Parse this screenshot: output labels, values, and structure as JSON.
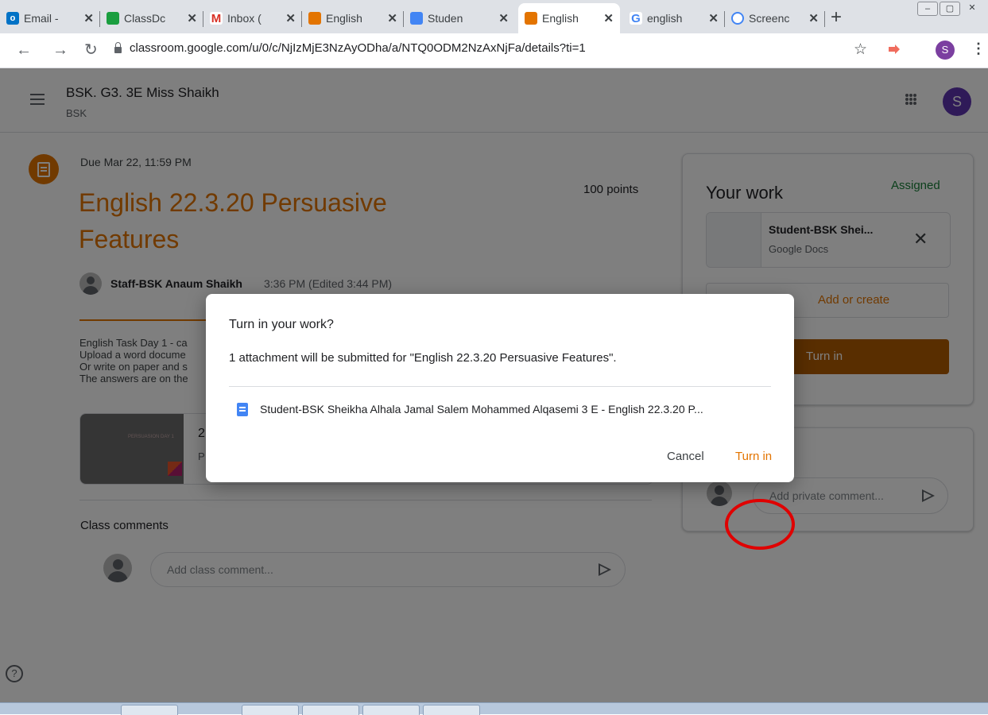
{
  "browser": {
    "tabs": [
      {
        "label": "Email -",
        "icon": "outlook-icon",
        "color": "#0072c6"
      },
      {
        "label": "ClassDc",
        "icon": "classdojo-icon",
        "color": "#1a9e3f"
      },
      {
        "label": "Inbox (",
        "icon": "gmail-icon",
        "color": "#d93025"
      },
      {
        "label": "English",
        "icon": "classroom-icon",
        "color": "#e37400"
      },
      {
        "label": "Studen",
        "icon": "docs-icon",
        "color": "#4285f4"
      },
      {
        "label": "English",
        "icon": "classroom-icon",
        "color": "#e37400",
        "active": true
      },
      {
        "label": "english",
        "icon": "google-icon",
        "color": "#4285f4"
      },
      {
        "label": "Screenc",
        "icon": "screencastify-icon",
        "color": "#4285f4"
      }
    ],
    "url": "classroom.google.com/u/0/c/NjIzMjE3NzAyODha/a/NTQ0ODM2NzAxNjFa/details?ti=1",
    "profile_initial": "S"
  },
  "header": {
    "class_name": "BSK. G3. 3E Miss Shaikh",
    "class_section": "BSK",
    "profile_initial": "S"
  },
  "assignment": {
    "due": "Due Mar 22, 11:59 PM",
    "title": "English 22.3.20 Persuasive Features",
    "points": "100 points",
    "author": "Staff-BSK Anaum Shaikh",
    "posted": "3:36 PM (Edited 3:44 PM)",
    "description_lines": [
      "English Task Day 1 - ca",
      "Upload a word docume",
      "Or write on paper and s",
      "The answers are on the"
    ],
    "attachment": {
      "title": "2",
      "subtitle": "P",
      "thumb_text": "PERSUASION DAY 1"
    },
    "class_comments_label": "Class comments",
    "class_comment_placeholder": "Add class comment..."
  },
  "your_work": {
    "title": "Your work",
    "status": "Assigned",
    "status_color": "#188038",
    "file_name": "Student-BSK Shei...",
    "file_type": "Google Docs",
    "add_label": "Add or create",
    "turn_in_label": "Turn in",
    "private_title": "ents",
    "private_placeholder": "Add private comment..."
  },
  "dialog": {
    "title": "Turn in your work?",
    "body": "1 attachment will be submitted for \"English 22.3.20 Persuasive Features\".",
    "file": "Student-BSK Sheikha Alhala Jamal Salem Mohammed Alqasemi 3 E - English 22.3.20 P...",
    "cancel_label": "Cancel",
    "turn_in_label": "Turn in"
  },
  "colors": {
    "accent": "#e37400",
    "turn_in_bg": "#b35c00",
    "highlight_ring": "#e00000"
  }
}
